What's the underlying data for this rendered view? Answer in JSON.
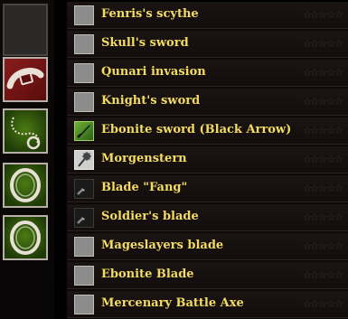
{
  "equipment_slots": [
    {
      "name": "empty-slot",
      "icon": "empty"
    },
    {
      "name": "belt",
      "icon": "belt-icon"
    },
    {
      "name": "amulet",
      "icon": "amulet-icon"
    },
    {
      "name": "ring-1",
      "icon": "ring-icon"
    },
    {
      "name": "ring-2",
      "icon": "ring-icon"
    }
  ],
  "items": [
    {
      "name": "Fenris's scythe",
      "icon": "blank-icon"
    },
    {
      "name": "Skull's sword",
      "icon": "blank-icon"
    },
    {
      "name": "Qunari invasion",
      "icon": "blank-icon"
    },
    {
      "name": "Knight's sword",
      "icon": "blank-icon"
    },
    {
      "name": "Ebonite sword (Black Arrow)",
      "icon": "sword-icon"
    },
    {
      "name": "Morgenstern",
      "icon": "mace-icon"
    },
    {
      "name": "Blade \"Fang\"",
      "icon": "blade-icon"
    },
    {
      "name": "Soldier's blade",
      "icon": "blade-icon"
    },
    {
      "name": "Mageslayers blade",
      "icon": "blank-icon"
    },
    {
      "name": "Ebonite Blade",
      "icon": "blank-icon"
    },
    {
      "name": "Mercenary Battle Axe",
      "icon": "blank-icon"
    }
  ],
  "rating_stars": "☆☆☆☆☆",
  "colors": {
    "item_name": "#f4dc63",
    "slot_red": "#8a1c1c",
    "slot_green": "#4b7a12"
  }
}
